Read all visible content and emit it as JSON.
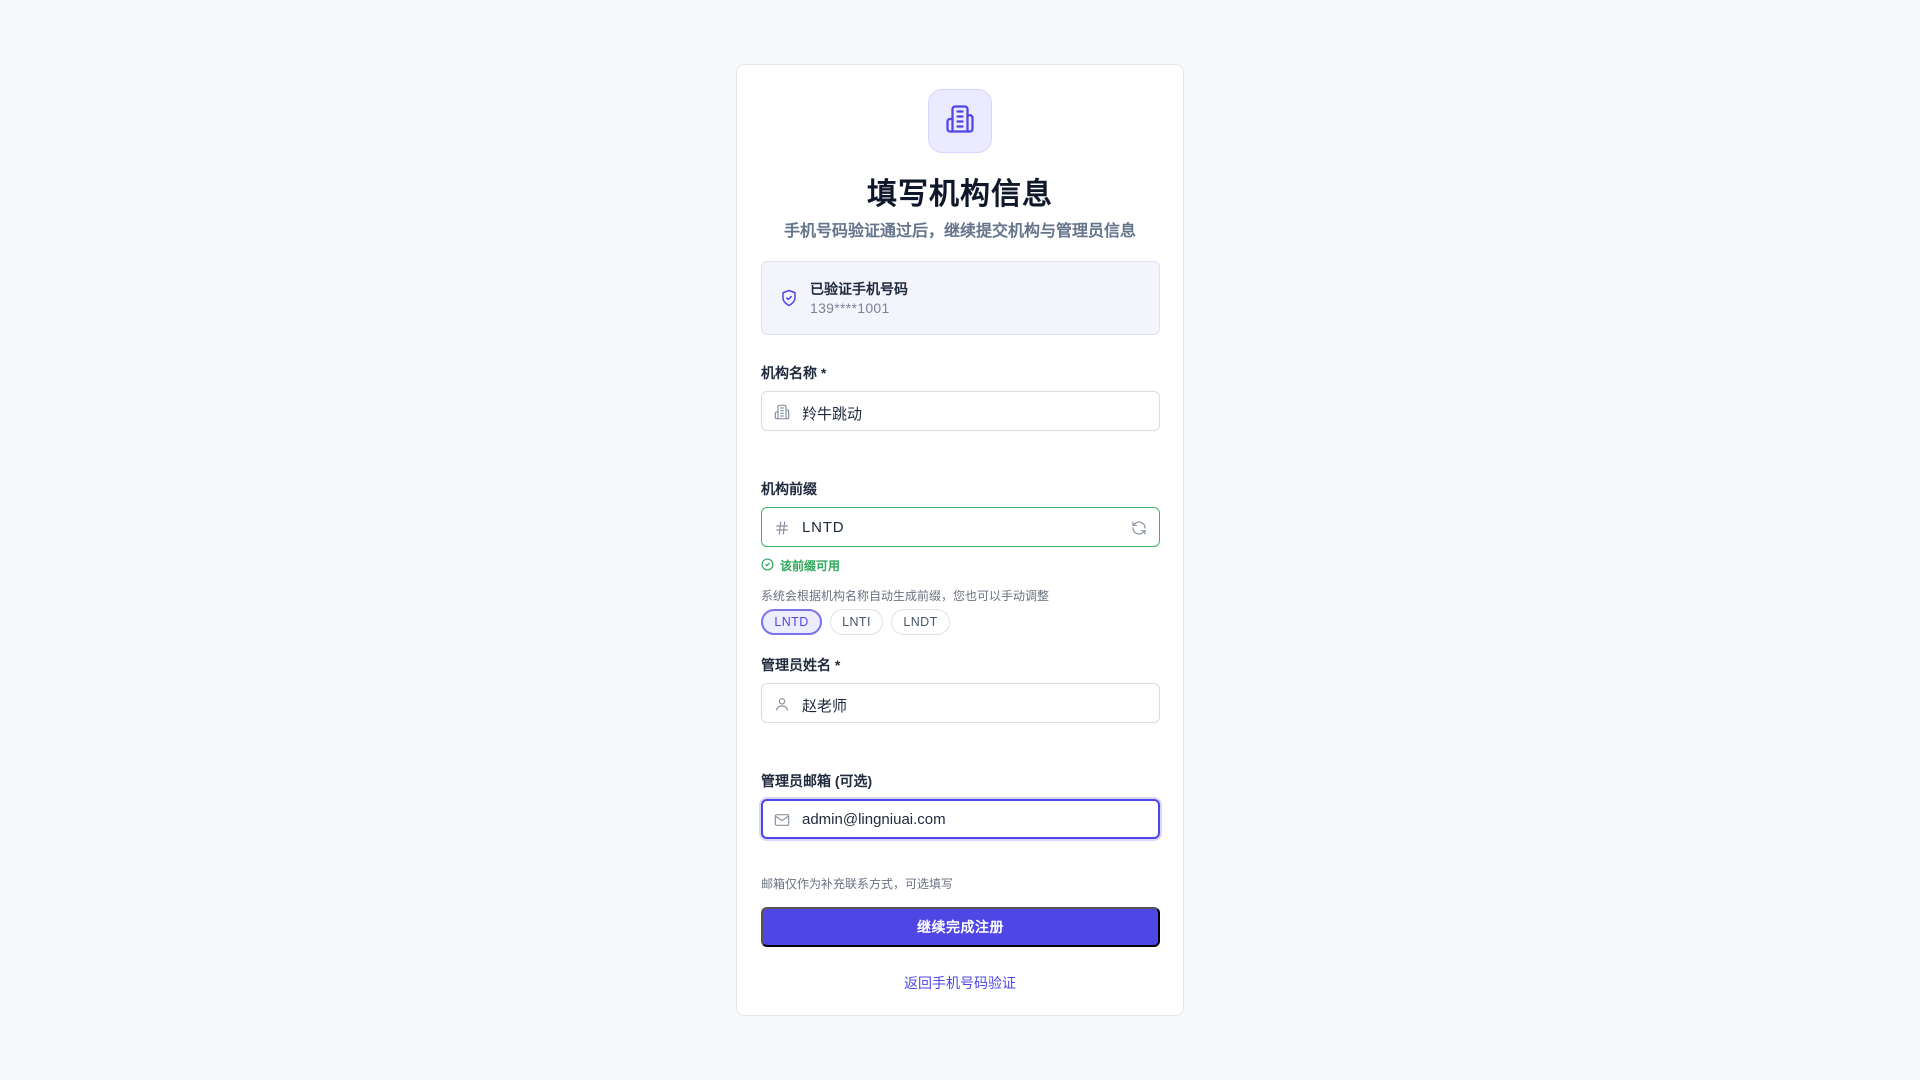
{
  "header": {
    "title": "填写机构信息",
    "subtitle": "手机号码验证通过后，继续提交机构与管理员信息"
  },
  "verified_phone": {
    "label": "已验证手机号码",
    "phone": "139****1001"
  },
  "org_name": {
    "label": "机构名称 *",
    "value": "羚牛跳动",
    "icon": "building-icon"
  },
  "org_prefix": {
    "label": "机构前缀",
    "value": "LNTD",
    "icon": "hash-icon",
    "status": "该前缀可用",
    "hint": "系统会根据机构名称自动生成前缀，您也可以手动调整",
    "suggestions": [
      "LNTD",
      "LNTI",
      "LNDT"
    ],
    "selected": "LNTD"
  },
  "admin_name": {
    "label": "管理员姓名 *",
    "value": "赵老师",
    "icon": "user-icon"
  },
  "admin_email": {
    "label": "管理员邮箱 (可选)",
    "value": "admin@lingniuai.com",
    "icon": "mail-icon",
    "hint": "邮箱仅作为补充联系方式，可选填写"
  },
  "actions": {
    "submit": "继续完成注册",
    "back": "返回手机号码验证"
  },
  "colors": {
    "primary": "#4f46e5",
    "success": "#2ea85c",
    "background": "#f8f9fb"
  }
}
